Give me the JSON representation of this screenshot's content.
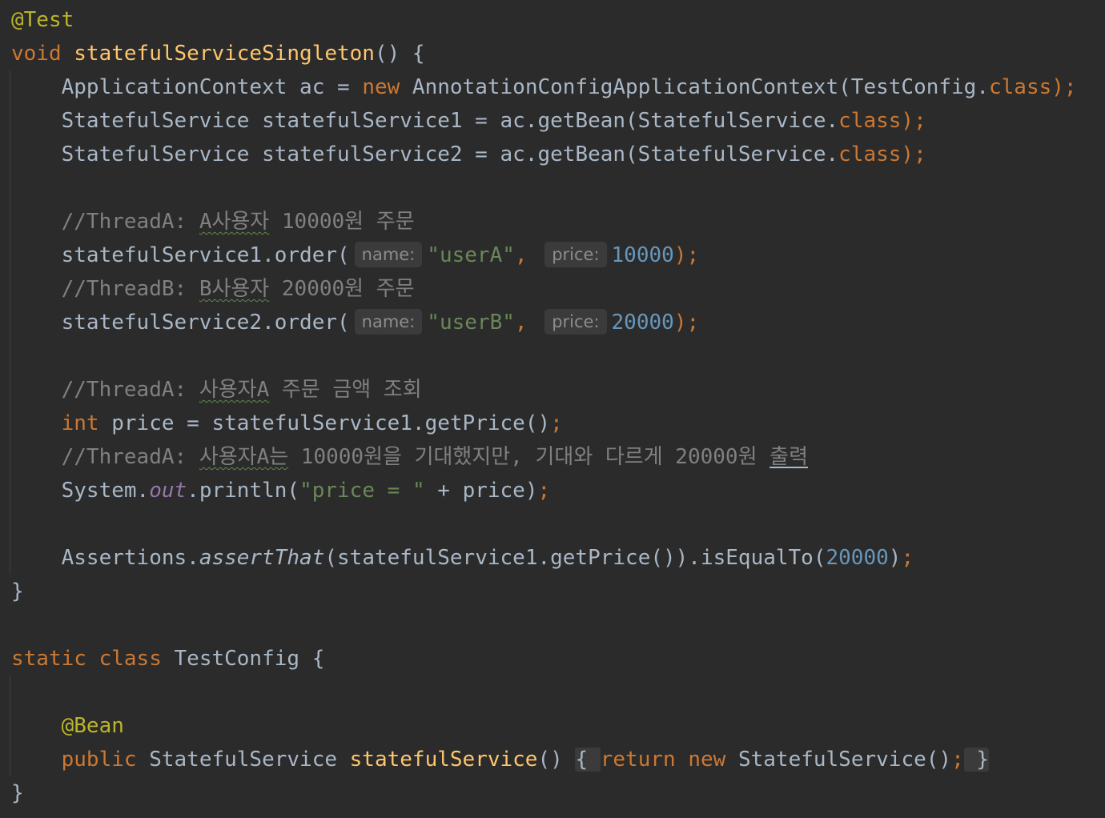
{
  "editor": {
    "lines": {
      "ann_test": "@Test",
      "l2_kw": "void",
      "l2_fn": "statefulServiceSingleton",
      "l2_rest": "() {",
      "l3_a": "ApplicationContext ac = ",
      "l3_new": "new",
      "l3_b": " AnnotationConfigApplicationContext(TestConfig.",
      "l3_class": "class",
      "l3_end": ");",
      "l4_a": "StatefulService statefulService1 = ac.getBean(StatefulService.",
      "l4_class": "class",
      "l4_end": ");",
      "l5_a": "StatefulService statefulService2 = ac.getBean(StatefulService.",
      "l5_class": "class",
      "l5_end": ");",
      "c1_pre": "//ThreadA: ",
      "c1_typo": "A사용자",
      "c1_post": " 10000원 주문",
      "o1_a": "statefulService1.order(",
      "o1_hint1": "name:",
      "o1_str": "\"userA\"",
      "o1_comma": ", ",
      "o1_hint2": "price:",
      "o1_num": "10000",
      "o1_end": ");",
      "c2_pre": "//ThreadB: ",
      "c2_typo": "B사용자",
      "c2_post": " 20000원 주문",
      "o2_a": "statefulService2.order(",
      "o2_hint1": "name:",
      "o2_str": "\"userB\"",
      "o2_comma": ", ",
      "o2_hint2": "price:",
      "o2_num": "20000",
      "o2_end": ");",
      "c3_pre": "//ThreadA: ",
      "c3_typo": "사용자A",
      "c3_post": " 주문 금액 조회",
      "p_kw": "int",
      "p_rest": " price = statefulService1.getPrice()",
      "p_end": ";",
      "c4_pre": "//ThreadA: ",
      "c4_typo": "사용자A는",
      "c4_mid": " 10000원을 기대했지만, 기대와 다르게 20000원 ",
      "c4_warn": "출력",
      "s_a": "System.",
      "s_out": "out",
      "s_b": ".println(",
      "s_str": "\"price = \"",
      "s_c": " + price)",
      "s_end": ";",
      "as_a": "Assertions.",
      "as_call": "assertThat",
      "as_b": "(statefulService1.getPrice()).isEqualTo(",
      "as_num": "20000",
      "as_c": ")",
      "as_end": ";",
      "close1": "}",
      "cls_static": "static",
      "cls_class": "class",
      "cls_rest": " TestConfig {",
      "ann_bean": "@Bean",
      "b_public": "public",
      "b_type": " StatefulService ",
      "b_fn": "statefulService",
      "b_paren": "()",
      "b_fold_open": "{ ",
      "b_return": "return",
      "b_new": "new",
      "b_ctor": " StatefulService()",
      "b_semi": ";",
      "b_fold_close": " }",
      "close2": "}"
    }
  }
}
